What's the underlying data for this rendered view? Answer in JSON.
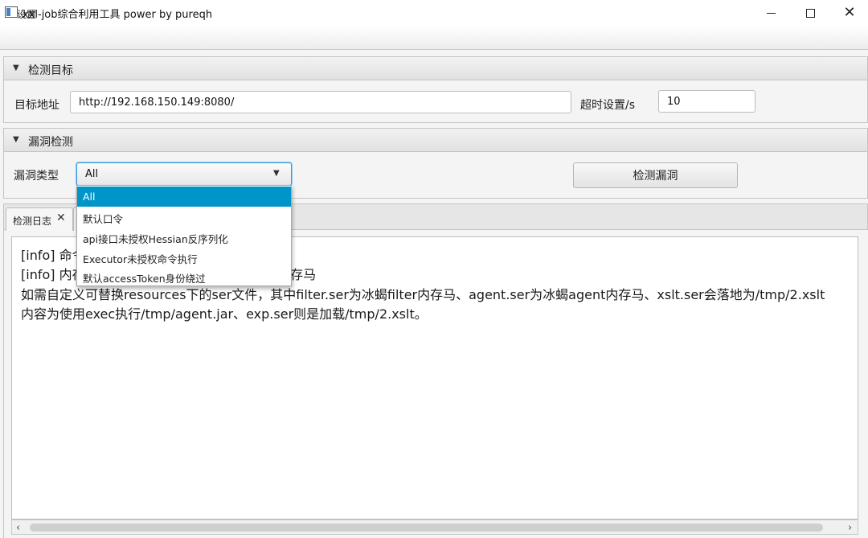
{
  "window": {
    "title": "xxl-job综合利用工具 power by pureqh",
    "minimize_glyph": "—",
    "maximize_glyph": "☐",
    "close_glyph": "✕"
  },
  "menu": {
    "items": [
      "设置"
    ]
  },
  "target_pane": {
    "title": "检测目标",
    "url_label": "目标地址",
    "url_value": "http://192.168.150.149:8080/",
    "timeout_label": "超时设置/s",
    "timeout_value": "10"
  },
  "vuln_pane": {
    "title": "漏洞检测",
    "type_label": "漏洞类型",
    "selected_type": "All",
    "detect_button": "检测漏洞"
  },
  "dropdown": {
    "options": [
      "All",
      "默认口令",
      "api接口未授权Hessian反序列化",
      "Executor未授权命令执行",
      "默认accessToken身份绕过"
    ],
    "highlighted_index": 0
  },
  "tabs": [
    {
      "label": "检测日志",
      "close": "✕"
    }
  ],
  "log": {
    "lines": [
      "[info] 命令执行和默认accessToken身份绕过。",
      "[info] 内存马提供了冰蝎Filter和Vagent两种内存马",
      "如需自定义可替换resources下的ser文件，其中filter.ser为冰蝎filter内存马、agent.ser为冰蝎agent内存马、xslt.ser会落地为/tmp/2.xslt",
      "内容为使用exec执行/tmp/agent.jar、exp.ser则是加载/tmp/2.xslt。"
    ]
  },
  "colors": {
    "accent": "#0095c8",
    "focus_border": "#3a9ad9"
  }
}
